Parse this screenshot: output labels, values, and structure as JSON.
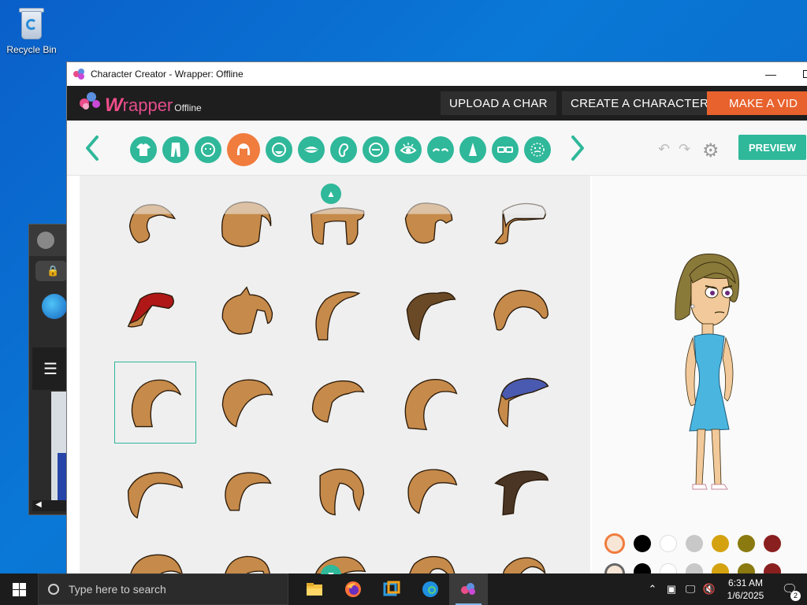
{
  "desktop": {
    "recycle_bin_label": "Recycle Bin"
  },
  "window": {
    "title": "Character Creator - Wrapper: Offline",
    "minimize_glyph": "—",
    "close_glyph": "✕"
  },
  "app": {
    "logo_w": "W",
    "logo_rest": "rapper",
    "logo_sub": "Offline",
    "nav": {
      "upload": "UPLOAD A CHAR",
      "create": "CREATE A CHARACTER",
      "make": "MAKE A VID"
    },
    "preview_label": "PREVIEW",
    "categories": [
      "upper-body",
      "lower-body",
      "face-shape",
      "hair",
      "chin",
      "mouth",
      "ear",
      "nose-bridge",
      "eyes",
      "eyebrows",
      "nose",
      "glasses",
      "mustache"
    ],
    "active_category": "hair",
    "undo_glyph": "↶",
    "redo_glyph": "↷",
    "gear_glyph": "⚙"
  },
  "hair_grid": {
    "selected_index": 10,
    "items": [
      {
        "shape": "swept-short",
        "color": "#c68a4a"
      },
      {
        "shape": "bob",
        "color": "#c68a4a"
      },
      {
        "shape": "flat-bob",
        "color": "#c68a4a"
      },
      {
        "shape": "wavy-bob",
        "color": "#c68a4a"
      },
      {
        "shape": "cap-white",
        "color": "#c68a4a"
      },
      {
        "shape": "cap-red",
        "color": "#c68a4a"
      },
      {
        "shape": "spiky-pony",
        "color": "#c68a4a"
      },
      {
        "shape": "side-long",
        "color": "#c68a4a"
      },
      {
        "shape": "dark-swoop",
        "color": "#6a4a26"
      },
      {
        "shape": "round-bowl",
        "color": "#c68a4a"
      },
      {
        "shape": "messy-long",
        "color": "#c68a4a"
      },
      {
        "shape": "curly-bob",
        "color": "#c68a4a"
      },
      {
        "shape": "curly-side",
        "color": "#c68a4a"
      },
      {
        "shape": "curly-long",
        "color": "#c68a4a"
      },
      {
        "shape": "cap-blue",
        "color": "#c68a4a"
      },
      {
        "shape": "side-sweep-gray",
        "color": "#c68a4a"
      },
      {
        "shape": "short-sweep",
        "color": "#c68a4a"
      },
      {
        "shape": "pony-long",
        "color": "#c68a4a"
      },
      {
        "shape": "med-sweep",
        "color": "#c68a4a"
      },
      {
        "shape": "dark-sweep",
        "color": "#4a3424"
      },
      {
        "shape": "shaggy",
        "color": "#c68a4a"
      },
      {
        "shape": "pigtails",
        "color": "#c68a4a"
      },
      {
        "shape": "curly-top",
        "color": "#c68a4a"
      },
      {
        "shape": "long-straight",
        "color": "#c68a4a"
      },
      {
        "shape": "long-curl",
        "color": "#c68a4a"
      }
    ]
  },
  "swatches_row1": [
    "#000000",
    "#ffffff",
    "#c8c8c8",
    "#d4a20f",
    "#8a7a10",
    "#8a1f1f"
  ],
  "swatches_row2": [
    "#000000",
    "#ffffff",
    "#c8c8c8",
    "#d4a20f",
    "#8a7a10",
    "#8a1f1f"
  ],
  "taskbar": {
    "search_placeholder": "Type here to search",
    "time": "6:31 AM",
    "date": "1/6/2025",
    "notification_count": "2",
    "apps": [
      "file-explorer",
      "firefox",
      "virtualbox",
      "edge",
      "wrapper-offline"
    ]
  },
  "colors": {
    "accent": "#2fb89a",
    "active_category": "#f07c3e",
    "make_button": "#e8622d",
    "appbar": "#1e1e1e",
    "hair": "#c68a4a"
  }
}
